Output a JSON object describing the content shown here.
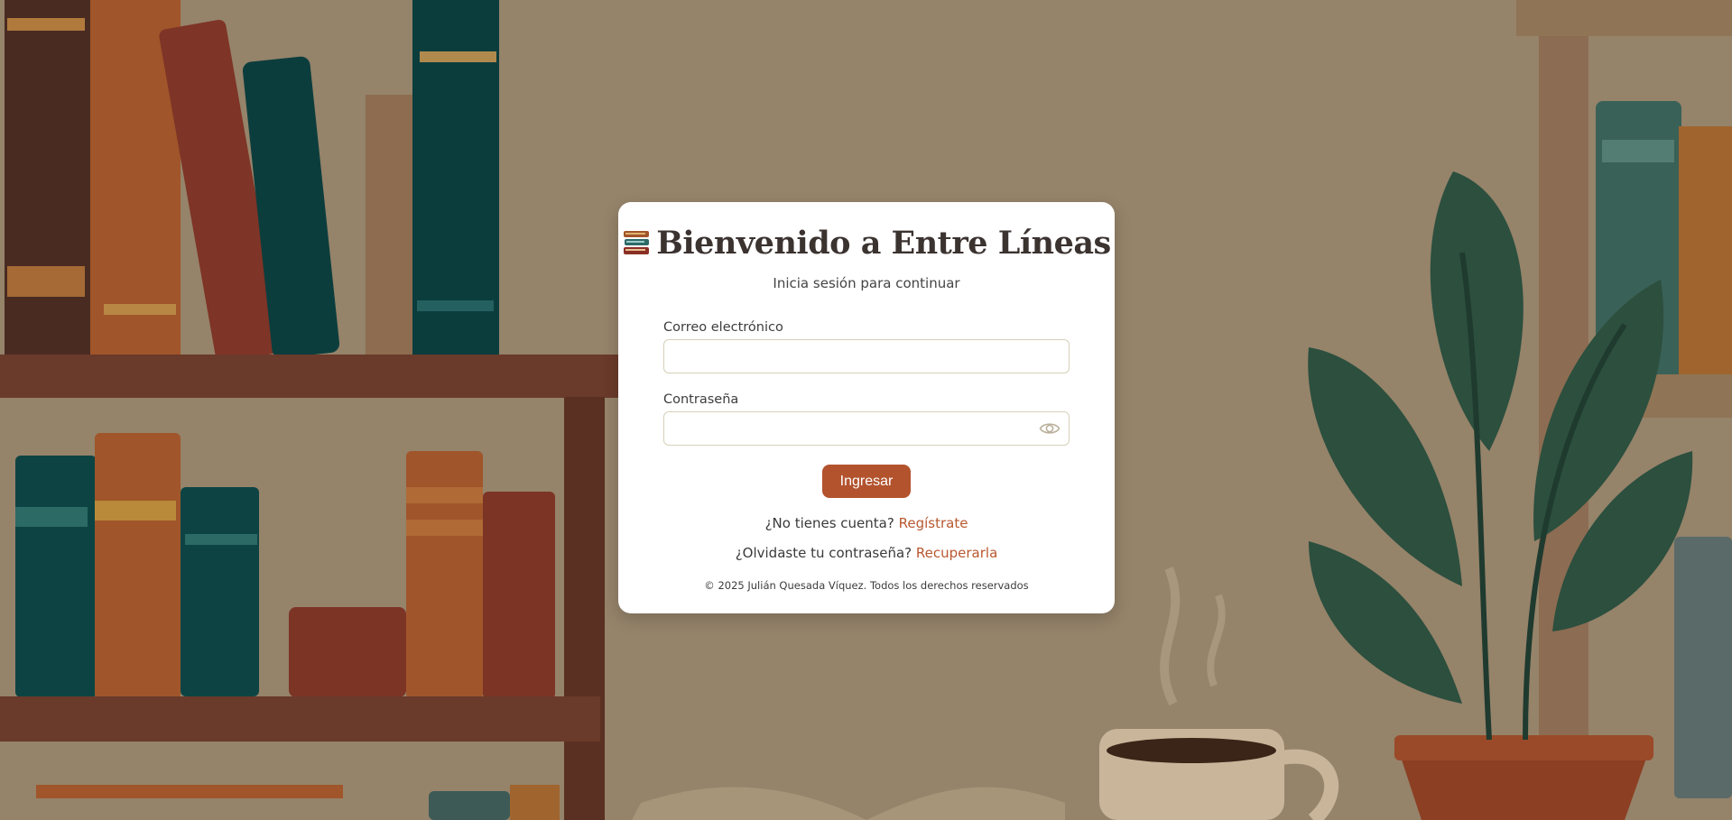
{
  "colors": {
    "accent": "#b3532e",
    "link": "#b8582f",
    "card_background": "#ffffff",
    "page_background": "#95836a"
  },
  "header": {
    "icon": "books-icon",
    "title": "Bienvenido a Entre Líneas",
    "subtitle": "Inicia sesión para continuar"
  },
  "form": {
    "email_label": "Correo electrónico",
    "email_value": "",
    "password_label": "Contraseña",
    "password_value": "",
    "toggle_icon": "eye-icon",
    "submit_label": "Ingresar"
  },
  "links": {
    "register_prompt": "¿No tienes cuenta?",
    "register_link": "Regístrate",
    "recover_prompt": "¿Olvidaste tu contraseña?",
    "recover_link": "Recuperarla"
  },
  "footer": {
    "text": "© 2025 Julián Quesada Víquez. Todos los derechos reservados"
  }
}
